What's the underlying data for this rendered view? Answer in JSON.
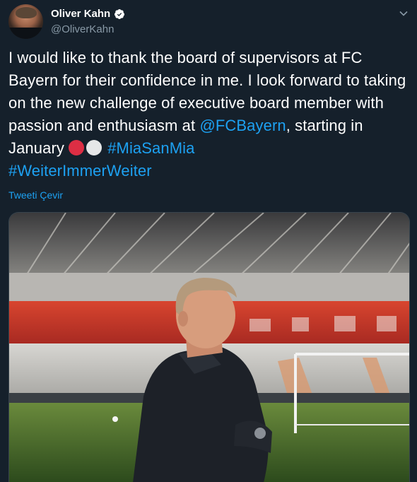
{
  "author": {
    "display_name": "Oliver Kahn",
    "handle": "@OliverKahn",
    "verified": true
  },
  "icons": {
    "verified": "verified-badge-icon",
    "more": "chevron-down-icon"
  },
  "tweet": {
    "text_part1": "I would like to thank the board of supervisors at FC Bayern for their confidence in me. I look forward to taking on the new challenge of executive board member with passion and enthusiasm at ",
    "mention": "@FCBayern",
    "text_part2": ", starting in January ",
    "hashtag1": "#MiaSanMia",
    "hashtag2": "#WeiterImmerWeiter",
    "emoji": [
      "red-circle",
      "white-circle"
    ]
  },
  "translate_label": "Tweeti Çevir",
  "colors": {
    "background": "#15202b",
    "link": "#1da1f2",
    "secondary_text": "#8899a6",
    "red_circle": "#dd2e44",
    "white_circle": "#e6e7e8"
  },
  "media": {
    "description_icon": "stadium-photo"
  }
}
